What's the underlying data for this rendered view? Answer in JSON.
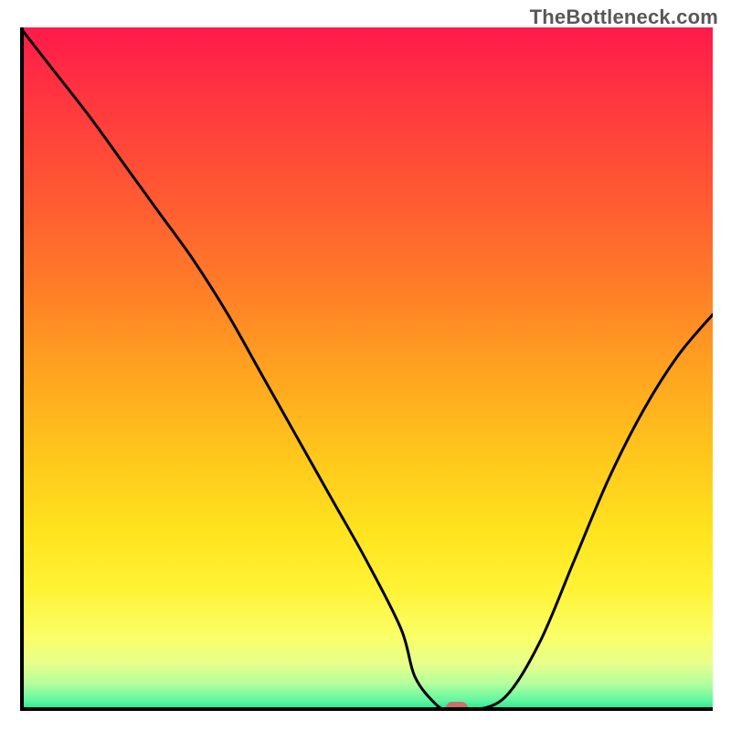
{
  "watermark": "TheBottleneck.com",
  "chart_data": {
    "type": "line",
    "title": "",
    "xlabel": "",
    "ylabel": "",
    "xlim": [
      0,
      100
    ],
    "ylim": [
      0,
      100
    ],
    "x": [
      0,
      5,
      10,
      15,
      20,
      25,
      30,
      35,
      40,
      45,
      50,
      55,
      57,
      60,
      62,
      65,
      70,
      75,
      80,
      85,
      90,
      95,
      100
    ],
    "values": [
      100,
      93.5,
      87,
      80,
      73,
      66,
      58,
      49,
      40,
      31,
      22,
      12,
      5,
      1,
      0,
      0,
      2,
      10,
      22,
      34,
      44,
      52,
      58
    ],
    "marker": {
      "x": 63,
      "y": 0,
      "color": "#cd6e6c"
    },
    "gradient_stops": [
      {
        "offset": 0.0,
        "color": "#ff1a4b"
      },
      {
        "offset": 0.12,
        "color": "#ff3a3e"
      },
      {
        "offset": 0.25,
        "color": "#ff5a32"
      },
      {
        "offset": 0.38,
        "color": "#ff7d28"
      },
      {
        "offset": 0.5,
        "color": "#ffa220"
      },
      {
        "offset": 0.62,
        "color": "#ffc51c"
      },
      {
        "offset": 0.74,
        "color": "#ffe41e"
      },
      {
        "offset": 0.82,
        "color": "#fff235"
      },
      {
        "offset": 0.89,
        "color": "#faff66"
      },
      {
        "offset": 0.93,
        "color": "#e8ff8a"
      },
      {
        "offset": 0.96,
        "color": "#b4ff9c"
      },
      {
        "offset": 0.985,
        "color": "#5ff7a0"
      },
      {
        "offset": 1.0,
        "color": "#18e08a"
      }
    ]
  }
}
